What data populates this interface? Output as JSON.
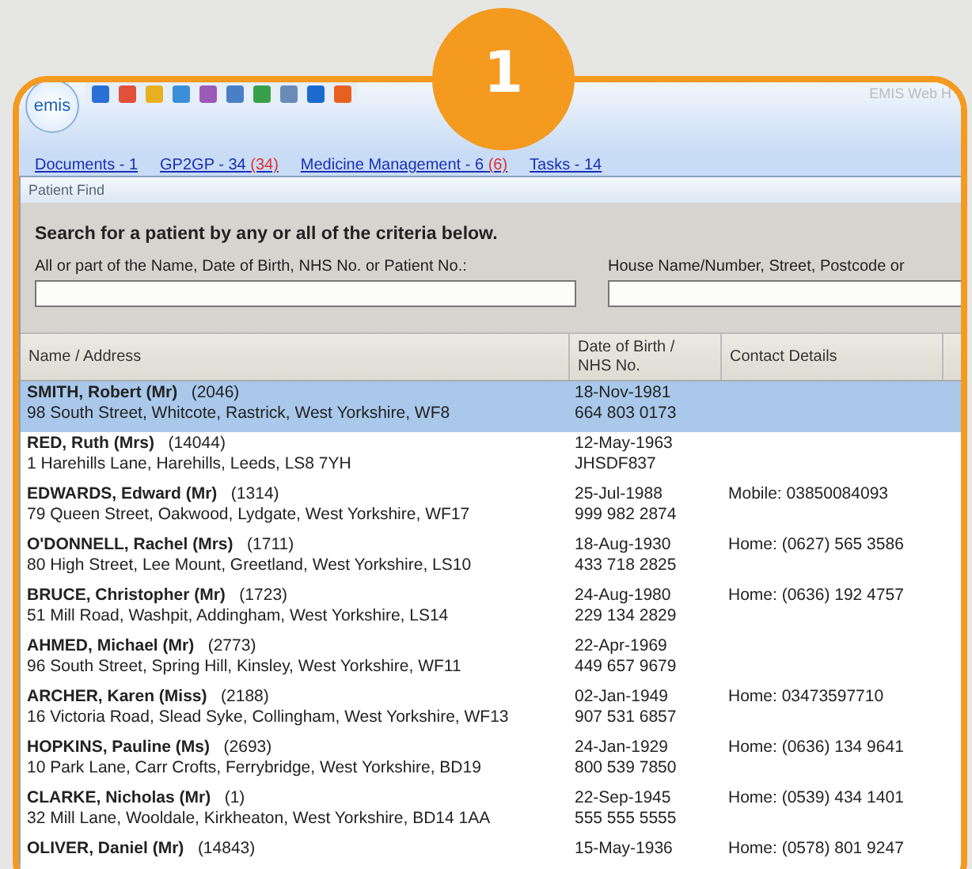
{
  "step_badge": "1",
  "app": {
    "logo": "emis",
    "title": "EMIS Web H"
  },
  "links": [
    {
      "label": "Documents - 1"
    },
    {
      "label": "GP2GP - 34",
      "alert": "(34)"
    },
    {
      "label": "Medicine Management - 6",
      "alert": "(6)"
    },
    {
      "label": "Tasks - 14"
    }
  ],
  "dialog": {
    "title": "Patient Find",
    "heading": "Search for a patient by any or all of the criteria below.",
    "fields": [
      {
        "label": "All or part of the Name, Date of Birth, NHS No. or Patient No.:"
      },
      {
        "label": "House Name/Number, Street, Postcode or"
      }
    ]
  },
  "table": {
    "columns": [
      "Name / Address",
      "Date of Birth / NHS No.",
      "Contact Details"
    ],
    "rows": [
      {
        "name": "SMITH, Robert (Mr)",
        "number": "(2046)",
        "address": "98 South Street, Whitcote, Rastrick, West Yorkshire, WF8",
        "dob": "18-Nov-1981",
        "nhs": "664 803 0173",
        "selected": true
      },
      {
        "name": "RED, Ruth (Mrs)",
        "number": "(14044)",
        "address": "1 Harehills Lane, Harehills, Leeds, LS8 7YH",
        "dob": "12-May-1963",
        "nhs": "JHSDF837",
        "selected": false
      },
      {
        "name": "EDWARDS, Edward (Mr)",
        "number": "(1314)",
        "address": "79 Queen Street, Oakwood, Lydgate, West Yorkshire, WF17",
        "dob": "25-Jul-1988",
        "nhs": "999 982 2874",
        "contact": "Mobile: 03850084093",
        "selected": false
      },
      {
        "name": "O'DONNELL, Rachel (Mrs)",
        "number": "(1711)",
        "address": "80 High Street, Lee Mount, Greetland, West Yorkshire, LS10",
        "dob": "18-Aug-1930",
        "nhs": "433 718 2825",
        "contact": "Home: (0627) 565 3586",
        "selected": false
      },
      {
        "name": "BRUCE, Christopher (Mr)",
        "number": "(1723)",
        "address": "51 Mill Road, Washpit, Addingham, West Yorkshire, LS14",
        "dob": "24-Aug-1980",
        "nhs": "229 134 2829",
        "contact": "Home: (0636) 192 4757",
        "selected": false
      },
      {
        "name": "AHMED, Michael (Mr)",
        "number": "(2773)",
        "address": "96 South Street, Spring Hill, Kinsley, West Yorkshire, WF11",
        "dob": "22-Apr-1969",
        "nhs": "449 657 9679",
        "selected": false
      },
      {
        "name": "ARCHER, Karen (Miss)",
        "number": "(2188)",
        "address": "16 Victoria Road, Slead Syke, Collingham, West Yorkshire, WF13",
        "dob": "02-Jan-1949",
        "nhs": "907 531 6857",
        "contact": "Home: 03473597710",
        "selected": false
      },
      {
        "name": "HOPKINS, Pauline (Ms)",
        "number": "(2693)",
        "address": "10 Park Lane, Carr Crofts, Ferrybridge, West Yorkshire, BD19",
        "dob": "24-Jan-1929",
        "nhs": "800 539 7850",
        "contact": "Home: (0636) 134 9641",
        "selected": false
      },
      {
        "name": "CLARKE, Nicholas (Mr)",
        "number": "(1)",
        "address": "32 Mill Lane, Wooldale, Kirkheaton, West Yorkshire, BD14 1AA",
        "dob": "22-Sep-1945",
        "nhs": "555 555 5555",
        "contact": "Home: (0539) 434 1401",
        "selected": false
      },
      {
        "name": "OLIVER, Daniel (Mr)",
        "number": "(14843)",
        "dob": "15-May-1936",
        "contact": "Home: (0578) 801 9247",
        "selected": false
      }
    ]
  }
}
